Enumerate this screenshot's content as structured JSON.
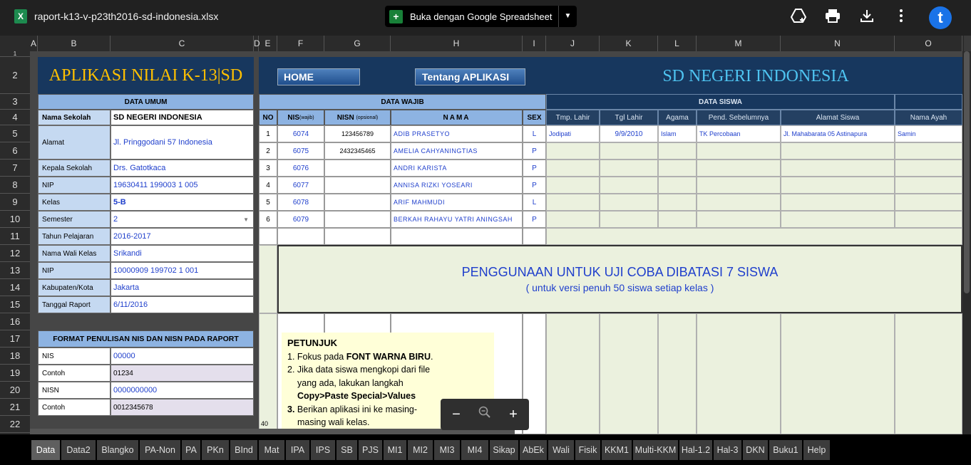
{
  "topbar": {
    "file_name": "raport-k13-v-p23th2016-sd-indonesia.xlsx",
    "excel_glyph": "X",
    "open_with": "Buka dengan Google Spreadsheet",
    "icons": [
      "add-to-drive-icon",
      "print-icon",
      "download-icon",
      "more-vert-icon"
    ],
    "avatar_letter": "t"
  },
  "columns": [
    "A",
    "B",
    "C",
    "D",
    "E",
    "F",
    "G",
    "H",
    "I",
    "J",
    "K",
    "L",
    "M",
    "N",
    "O"
  ],
  "rows": [
    "1",
    "2",
    "3",
    "4",
    "5",
    "6",
    "7",
    "8",
    "9",
    "10",
    "11",
    "12",
    "13",
    "14",
    "15",
    "16",
    "17",
    "18",
    "19",
    "20",
    "21",
    "22"
  ],
  "header": {
    "app_title": "APLIKASI NILAI K-13|SD",
    "home_button": "HOME",
    "about_button": "Tentang APLIKASI",
    "school_banner": "SD NEGERI INDONESIA"
  },
  "data_umum": {
    "title": "DATA UMUM",
    "fields": [
      {
        "label": "Nama Sekolah",
        "value": "SD NEGERI INDONESIA"
      },
      {
        "label": "Alamat",
        "value": "Jl. Pringgodani 57 Indonesia"
      },
      {
        "label": "Kepala Sekolah",
        "value": "Drs. Gatotkaca"
      },
      {
        "label": "NIP",
        "value": "19630411 199003 1 005"
      },
      {
        "label": "Kelas",
        "value": "5-B"
      },
      {
        "label": "Semester",
        "value": "2"
      },
      {
        "label": "Tahun Pelajaran",
        "value": "2016-2017"
      },
      {
        "label": "Nama Wali Kelas",
        "value": "Srikandi"
      },
      {
        "label": "NIP",
        "value": "10000909 199702 1 001"
      },
      {
        "label": "Kabupaten/Kota",
        "value": "Jakarta"
      },
      {
        "label": "Tanggal Raport",
        "value": "6/11/2016"
      }
    ]
  },
  "format_nis": {
    "title": "FORMAT PENULISAN NIS DAN NISN PADA RAPORT",
    "rows": [
      {
        "label": "NIS",
        "value": "00000"
      },
      {
        "label": "Contoh",
        "value": "01234"
      },
      {
        "label": "NISN",
        "value": "0000000000"
      },
      {
        "label": "Contoh",
        "value": "0012345678"
      }
    ]
  },
  "data_wajib": {
    "title": "DATA WAJIB",
    "col_no": "NO",
    "col_nis": "NIS",
    "col_nis_note": "(wajib)",
    "col_nisn": "NISN",
    "col_nisn_note": "(opsional)",
    "col_nama": "NAMA",
    "col_sex": "SEX"
  },
  "data_siswa": {
    "title": "DATA SISWA",
    "headers": [
      "Tmp. Lahir",
      "Tgl Lahir",
      "Agama",
      "Pend. Sebelumnya",
      "Alamat Siswa",
      "Nama Ayah"
    ]
  },
  "students": [
    {
      "no": "1",
      "nis": "6074",
      "nisn": "123456789",
      "nama": "ADIB PRASETYO",
      "sex": "L",
      "tmp": "Jodipati",
      "tgl": "9/9/2010",
      "agama": "Islam",
      "pend": "TK Percobaan",
      "alamat": "Jl. Mahabarata 05 Astinapura",
      "ayah": "Samin"
    },
    {
      "no": "2",
      "nis": "6075",
      "nisn": "2432345465",
      "nama": "AMELIA CAHYANINGTIAS",
      "sex": "P",
      "tmp": "",
      "tgl": "",
      "agama": "",
      "pend": "",
      "alamat": "",
      "ayah": ""
    },
    {
      "no": "3",
      "nis": "6076",
      "nisn": "",
      "nama": "ANDRI KARISTA",
      "sex": "P",
      "tmp": "",
      "tgl": "",
      "agama": "",
      "pend": "",
      "alamat": "",
      "ayah": ""
    },
    {
      "no": "4",
      "nis": "6077",
      "nisn": "",
      "nama": "ANNISA RIZKI YOSEARI",
      "sex": "P",
      "tmp": "",
      "tgl": "",
      "agama": "",
      "pend": "",
      "alamat": "",
      "ayah": ""
    },
    {
      "no": "5",
      "nis": "6078",
      "nisn": "",
      "nama": "ARIF MAHMUDI",
      "sex": "L",
      "tmp": "",
      "tgl": "",
      "agama": "",
      "pend": "",
      "alamat": "",
      "ayah": ""
    },
    {
      "no": "6",
      "nis": "6079",
      "nisn": "",
      "nama": "BERKAH RAHAYU YATRI ANINGSAH",
      "sex": "P",
      "tmp": "",
      "tgl": "",
      "agama": "",
      "pend": "",
      "alamat": "",
      "ayah": ""
    }
  ],
  "notice": {
    "line1": "PENGGUNAAN UNTUK UJI COBA DIBATASI 7 SISWA",
    "line2": "( untuk versi penuh 50 siswa setiap kelas )"
  },
  "row_40_label": "40",
  "petunjuk": {
    "title": "PETUNJUK",
    "l1a": "1. Fokus pada ",
    "l1b": "FONT WARNA BIRU",
    "l1c": ".",
    "l2": "2. Jika data siswa mengkopi dari file",
    "l3": "yang ada, lakukan langkah",
    "l4": "Copy>Paste Special>Values",
    "l5a": "3.",
    "l5b": " Berikan aplikasi ini ke masing-",
    "l6": "masing wali kelas."
  },
  "zoom": {
    "minus": "−",
    "plus": "+"
  },
  "sheet_tabs": [
    "Data",
    "Data2",
    "Blangko",
    "PA-Non",
    "PA",
    "PKn",
    "BInd",
    "Mat",
    "IPA",
    "IPS",
    "SB",
    "PJS",
    "MI1",
    "MI2",
    "MI3",
    "MI4",
    "Sikap",
    "AbEk",
    "Wali",
    "Fisik",
    "KKM1",
    "Multi-KKM",
    "Hal-1.2",
    "Hal-3",
    "DKN",
    "Buku1",
    "Help"
  ],
  "active_tab": "Data",
  "colors": {
    "label_blue": "#c5d9f1",
    "header_blue": "#8db3e2",
    "navy": "#17375e",
    "green": "#ebf1de",
    "value_blue": "#1f3fcc",
    "title_gold": "#ffc000"
  }
}
